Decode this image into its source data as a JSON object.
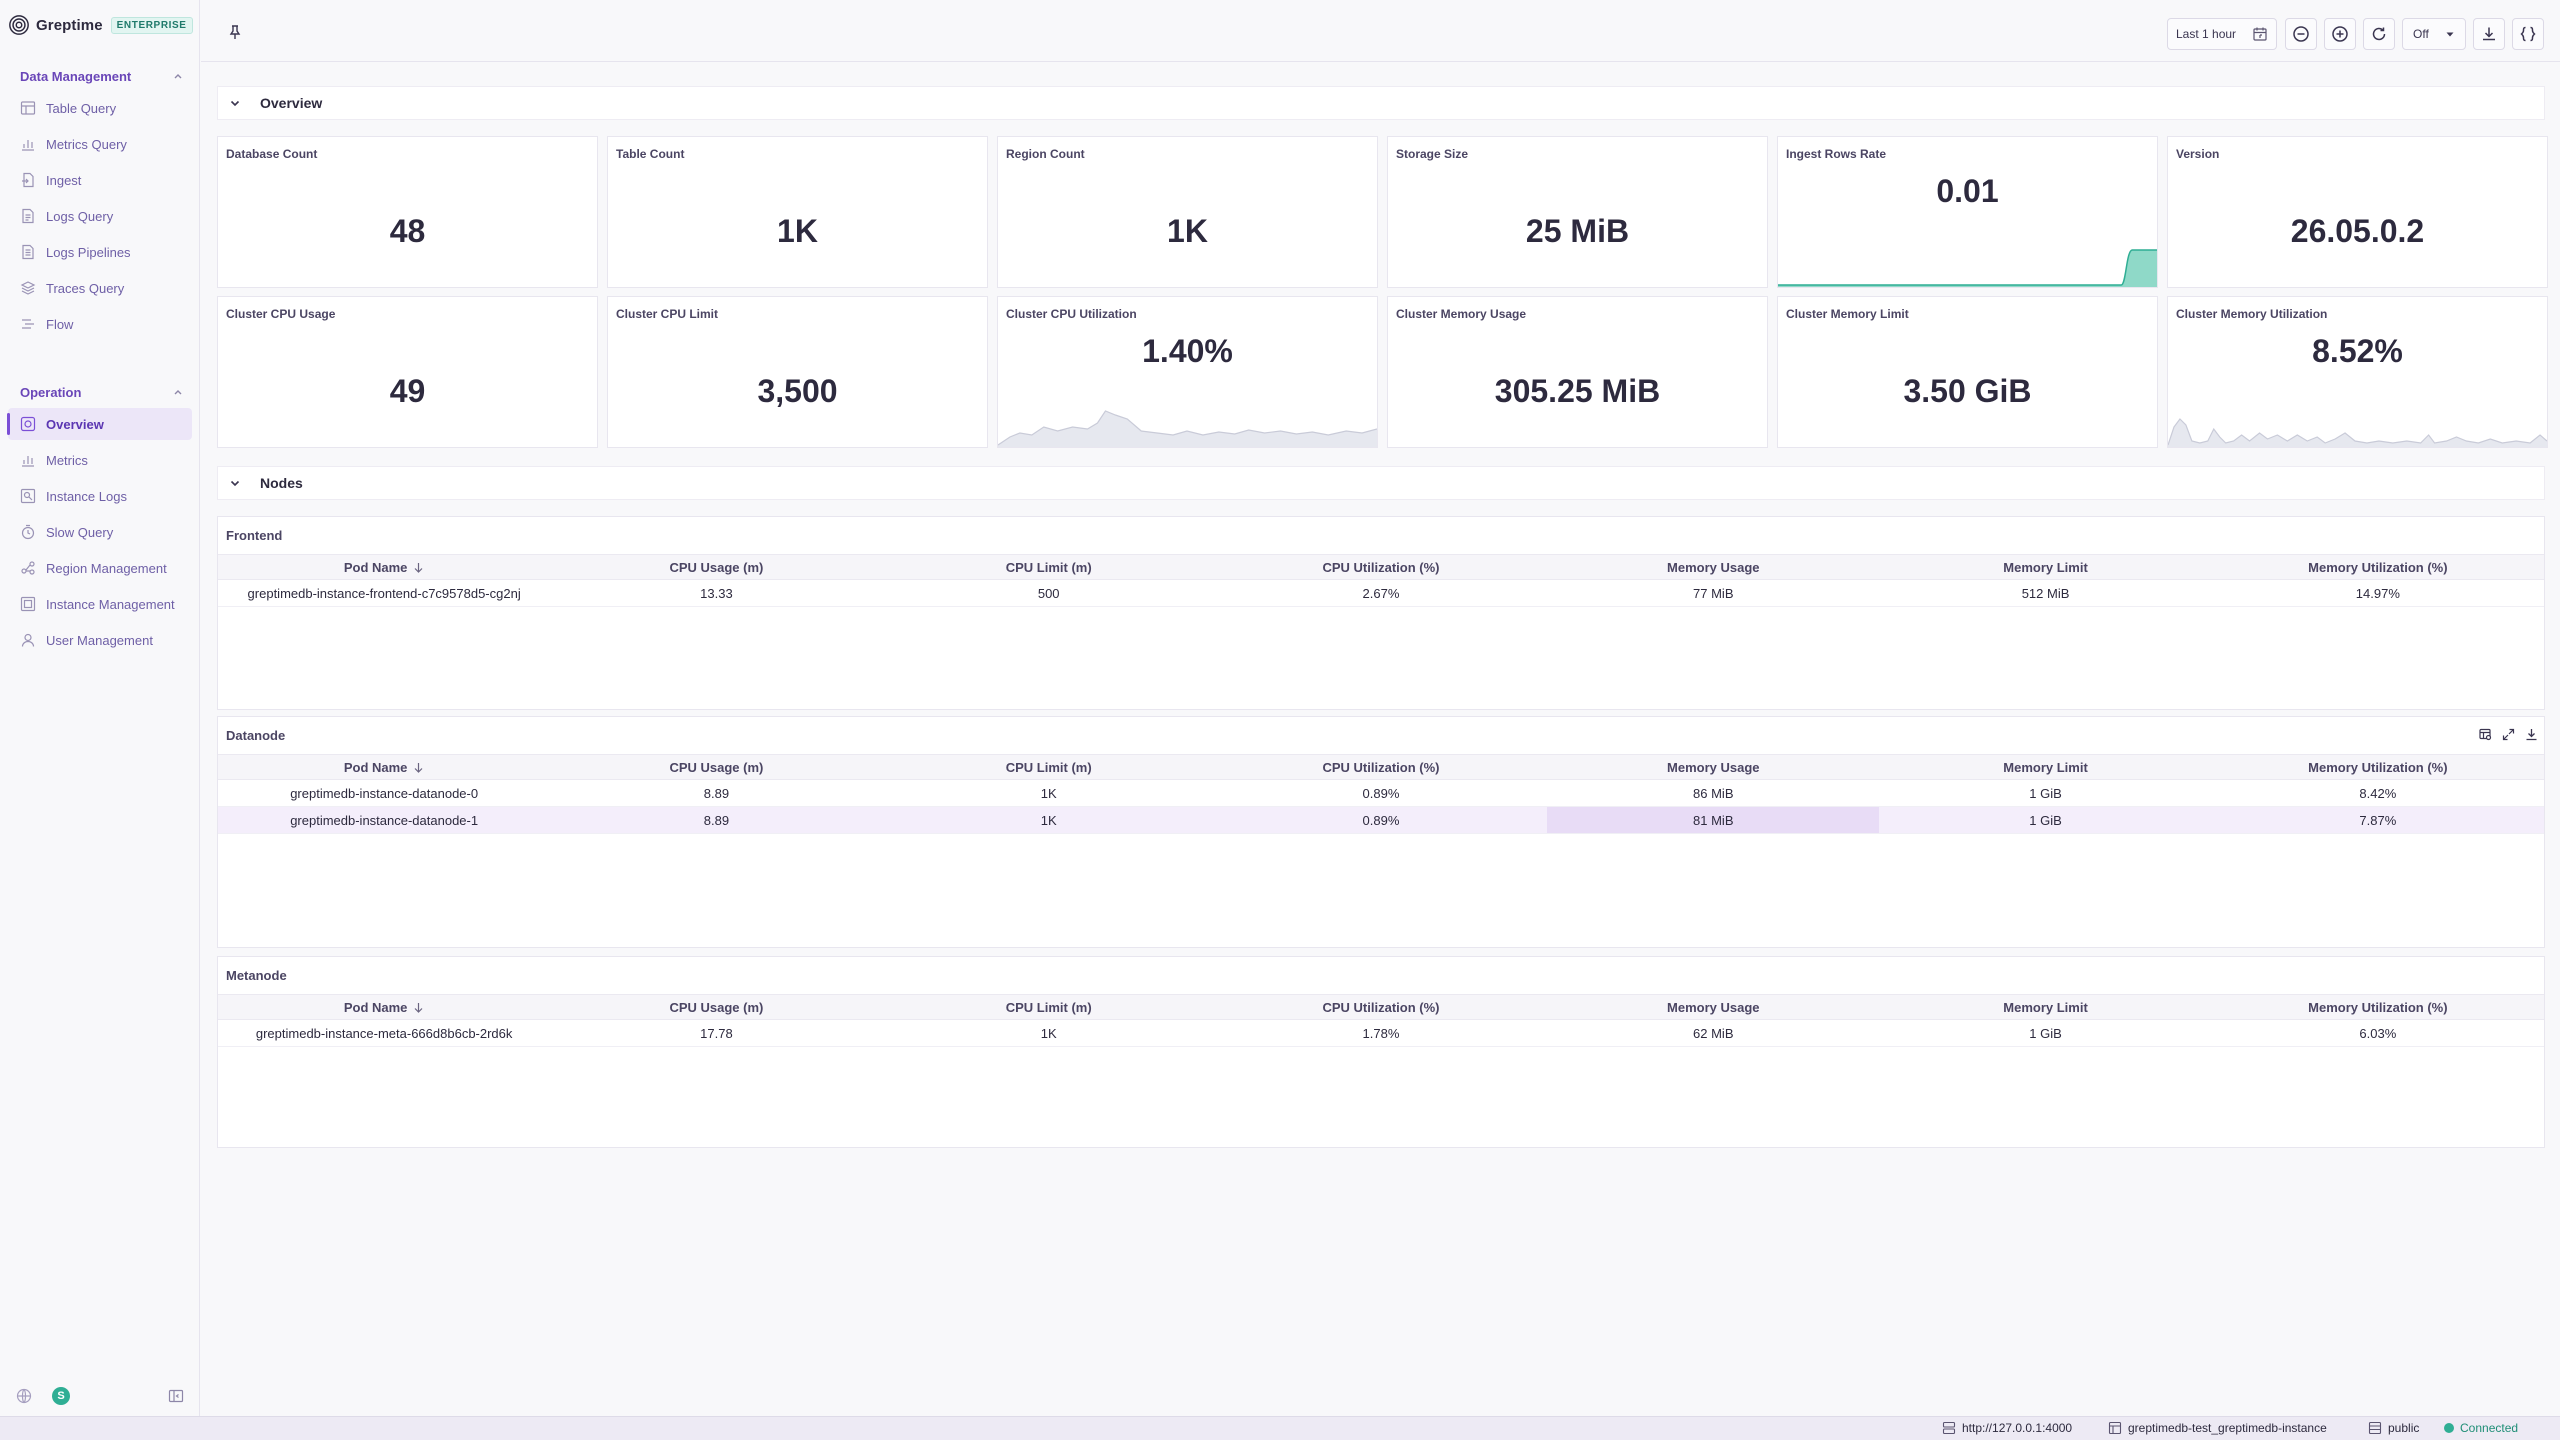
{
  "brand": {
    "name": "Greptime",
    "badge": "ENTERPRISE"
  },
  "sidebar": {
    "sections": [
      {
        "title": "Data Management",
        "items": [
          {
            "label": "Table Query",
            "icon": "table-icon"
          },
          {
            "label": "Metrics Query",
            "icon": "chart-icon"
          },
          {
            "label": "Ingest",
            "icon": "file-import-icon"
          },
          {
            "label": "Logs Query",
            "icon": "document-icon"
          },
          {
            "label": "Logs Pipelines",
            "icon": "pipeline-icon"
          },
          {
            "label": "Traces Query",
            "icon": "layers-icon"
          },
          {
            "label": "Flow",
            "icon": "flow-icon"
          }
        ]
      },
      {
        "title": "Operation",
        "items": [
          {
            "label": "Overview",
            "icon": "overview-icon",
            "active": true
          },
          {
            "label": "Metrics",
            "icon": "chart-icon"
          },
          {
            "label": "Instance Logs",
            "icon": "search-document-icon"
          },
          {
            "label": "Slow Query",
            "icon": "timer-icon"
          },
          {
            "label": "Region Management",
            "icon": "region-icon"
          },
          {
            "label": "Instance Management",
            "icon": "instance-icon"
          },
          {
            "label": "User Management",
            "icon": "user-icon"
          }
        ]
      }
    ],
    "footer": {
      "avatar_initial": "S"
    }
  },
  "toolbar": {
    "time_range": "Last 1 hour",
    "refresh_interval": "Off"
  },
  "overview": {
    "title": "Overview",
    "stats_row1": [
      {
        "label": "Database Count",
        "value": "48"
      },
      {
        "label": "Table Count",
        "value": "1K"
      },
      {
        "label": "Region Count",
        "value": "1K"
      },
      {
        "label": "Storage Size",
        "value": "25 MiB"
      },
      {
        "label": "Ingest Rows Rate",
        "value": "0.01"
      },
      {
        "label": "Version",
        "value": "26.05.0.2"
      }
    ],
    "stats_row2": [
      {
        "label": "Cluster CPU Usage",
        "value": "49"
      },
      {
        "label": "Cluster CPU Limit",
        "value": "3,500"
      },
      {
        "label": "Cluster CPU Utilization",
        "value": "1.40%"
      },
      {
        "label": "Cluster Memory Usage",
        "value": "305.25 MiB"
      },
      {
        "label": "Cluster Memory Limit",
        "value": "3.50 GiB"
      },
      {
        "label": "Cluster Memory Utilization",
        "value": "8.52%"
      }
    ]
  },
  "nodes": {
    "title": "Nodes",
    "columns": [
      "Pod Name",
      "CPU Usage (m)",
      "CPU Limit (m)",
      "CPU Utilization (%)",
      "Memory Usage",
      "Memory Limit",
      "Memory Utilization (%)"
    ],
    "frontend": {
      "title": "Frontend",
      "rows": [
        [
          "greptimedb-instance-frontend-c7c9578d5-cg2nj",
          "13.33",
          "500",
          "2.67%",
          "77 MiB",
          "512 MiB",
          "14.97%"
        ]
      ]
    },
    "datanode": {
      "title": "Datanode",
      "rows": [
        [
          "greptimedb-instance-datanode-0",
          "8.89",
          "1K",
          "0.89%",
          "86 MiB",
          "1 GiB",
          "8.42%"
        ],
        [
          "greptimedb-instance-datanode-1",
          "8.89",
          "1K",
          "0.89%",
          "81 MiB",
          "1 GiB",
          "7.87%"
        ]
      ]
    },
    "metanode": {
      "title": "Metanode",
      "rows": [
        [
          "greptimedb-instance-meta-666d8b6cb-2rd6k",
          "17.78",
          "1K",
          "1.78%",
          "62 MiB",
          "1 GiB",
          "6.03%"
        ]
      ]
    }
  },
  "statusbar": {
    "url": "http://127.0.0.1:4000",
    "instance": "greptimedb-test_greptimedb-instance",
    "database": "public",
    "status": "Connected"
  },
  "colors": {
    "accent": "#7b4fd6",
    "success": "#2fae94",
    "chart_fill": "#8fd9c8",
    "chart_gray": "#d7d9e3"
  }
}
